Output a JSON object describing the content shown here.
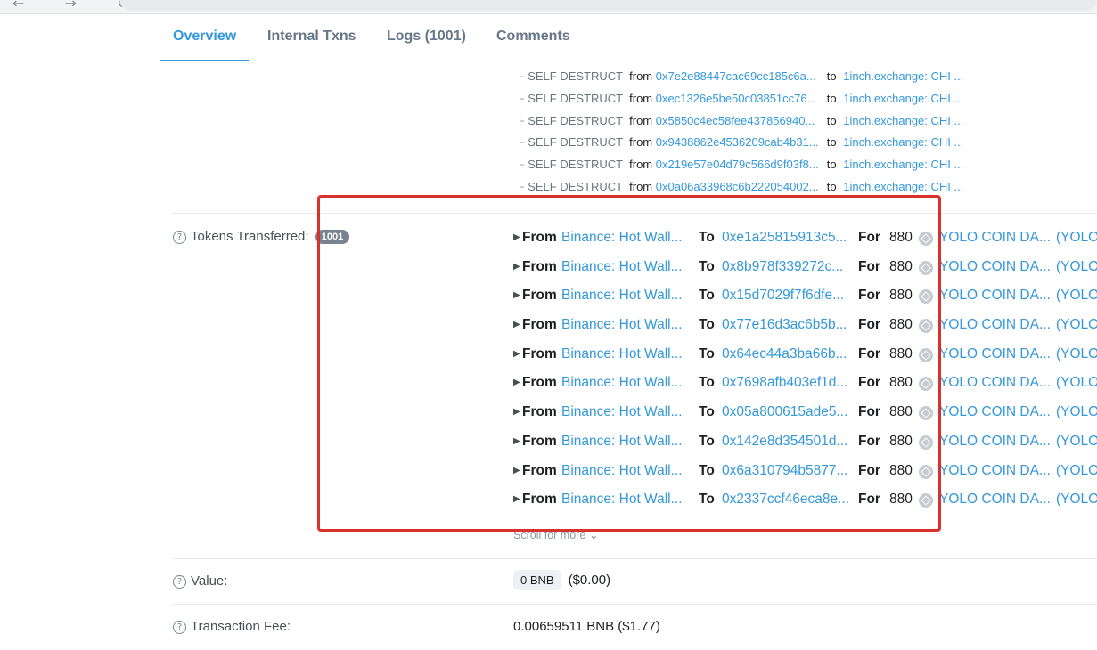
{
  "tabs": [
    {
      "label": "Overview"
    },
    {
      "label": "Internal Txns"
    },
    {
      "label": "Logs (1001)"
    },
    {
      "label": "Comments"
    }
  ],
  "self_destructs": [
    {
      "kind": "SELF DESTRUCT",
      "from": "0x7e2e88447cac69cc185c6a...",
      "to": "1inch.exchange: CHI ..."
    },
    {
      "kind": "SELF DESTRUCT",
      "from": "0xec1326e5be50c03851cc76...",
      "to": "1inch.exchange: CHI ..."
    },
    {
      "kind": "SELF DESTRUCT",
      "from": "0x5850c4ec58fee437856940...",
      "to": "1inch.exchange: CHI ..."
    },
    {
      "kind": "SELF DESTRUCT",
      "from": "0x9438862e4536209cab4b31...",
      "to": "1inch.exchange: CHI ..."
    },
    {
      "kind": "SELF DESTRUCT",
      "from": "0x219e57e04d79c566d9f03f8...",
      "to": "1inch.exchange: CHI ..."
    },
    {
      "kind": "SELF DESTRUCT",
      "from": "0x0a06a33968c6b222054002...",
      "to": "1inch.exchange: CHI ..."
    }
  ],
  "sd_labels": {
    "from": "from",
    "to": "to"
  },
  "tokens": {
    "label": "Tokens Transferred:",
    "count": "1001",
    "kw_from": "From",
    "kw_to": "To",
    "kw_for": "For",
    "transfers": [
      {
        "from": "Binance: Hot Wall...",
        "to": "0xe1a25815913c5...",
        "amount": "880",
        "token": "YOLO COIN DA...",
        "symbol": "(YOLO"
      },
      {
        "from": "Binance: Hot Wall...",
        "to": "0x8b978f339272c...",
        "amount": "880",
        "token": "YOLO COIN DA...",
        "symbol": "(YOLO"
      },
      {
        "from": "Binance: Hot Wall...",
        "to": "0x15d7029f7f6dfe...",
        "amount": "880",
        "token": "YOLO COIN DA...",
        "symbol": "(YOLO"
      },
      {
        "from": "Binance: Hot Wall...",
        "to": "0x77e16d3ac6b5b...",
        "amount": "880",
        "token": "YOLO COIN DA...",
        "symbol": "(YOLO"
      },
      {
        "from": "Binance: Hot Wall...",
        "to": "0x64ec44a3ba66b...",
        "amount": "880",
        "token": "YOLO COIN DA...",
        "symbol": "(YOLO"
      },
      {
        "from": "Binance: Hot Wall...",
        "to": "0x7698afb403ef1d...",
        "amount": "880",
        "token": "YOLO COIN DA...",
        "symbol": "(YOLO"
      },
      {
        "from": "Binance: Hot Wall...",
        "to": "0x05a800615ade5...",
        "amount": "880",
        "token": "YOLO COIN DA...",
        "symbol": "(YOLO"
      },
      {
        "from": "Binance: Hot Wall...",
        "to": "0x142e8d354501d...",
        "amount": "880",
        "token": "YOLO COIN DA...",
        "symbol": "(YOLO"
      },
      {
        "from": "Binance: Hot Wall...",
        "to": "0x6a310794b5877...",
        "amount": "880",
        "token": "YOLO COIN DA...",
        "symbol": "(YOLO"
      },
      {
        "from": "Binance: Hot Wall...",
        "to": "0x2337ccf46eca8e...",
        "amount": "880",
        "token": "YOLO COIN DA...",
        "symbol": "(YOLO"
      }
    ],
    "scroll_more": "Scroll for more"
  },
  "value": {
    "label": "Value:",
    "amount": "0 BNB",
    "usd": "($0.00)"
  },
  "fee": {
    "label": "Transaction Fee:",
    "amount": "0.00659511 BNB ($1.77)"
  },
  "colors": {
    "link": "#3498db",
    "highlight": "#d9312b",
    "badge": "#77838f"
  }
}
